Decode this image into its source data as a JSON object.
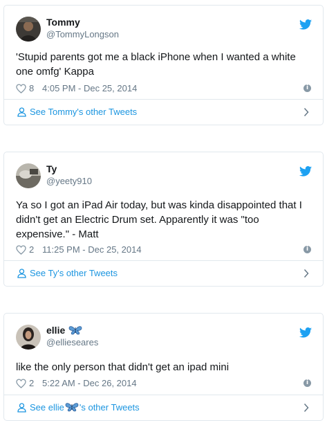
{
  "tweets": [
    {
      "name": "Tommy",
      "handle": "@TommyLongson",
      "text": "'Stupid parents got me a black iPhone when I wanted a white one omfg' Kappa",
      "likes": "8",
      "timestamp": "4:05 PM - Dec 25, 2014",
      "footer": "See Tommy's other Tweets"
    },
    {
      "name": "Ty",
      "handle": "@yeety910",
      "text": "Ya so I got an iPad Air today, but was kinda disappointed that I didn't get an Electric Drum set. Apparently it was \"too expensive.\" - Matt",
      "likes": "2",
      "timestamp": "11:25 PM - Dec 25, 2014",
      "footer": "See Ty's other Tweets"
    },
    {
      "name": "ellie",
      "handle": "@ellieseares",
      "text": "like the only person that didn't get an ipad mini",
      "likes": "2",
      "timestamp": "5:22 AM - Dec 26, 2014",
      "footer_prefix": "See ellie",
      "footer_suffix": "'s other Tweets"
    }
  ],
  "colors": {
    "link": "#1b95e0",
    "twitter_blue": "#1da1f2",
    "muted": "#657786",
    "border": "#e1e8ed"
  },
  "icons": [
    "twitter-bird-icon",
    "heart-icon",
    "info-icon",
    "person-icon",
    "chevron-right-icon",
    "butterfly-emoji-icon"
  ]
}
